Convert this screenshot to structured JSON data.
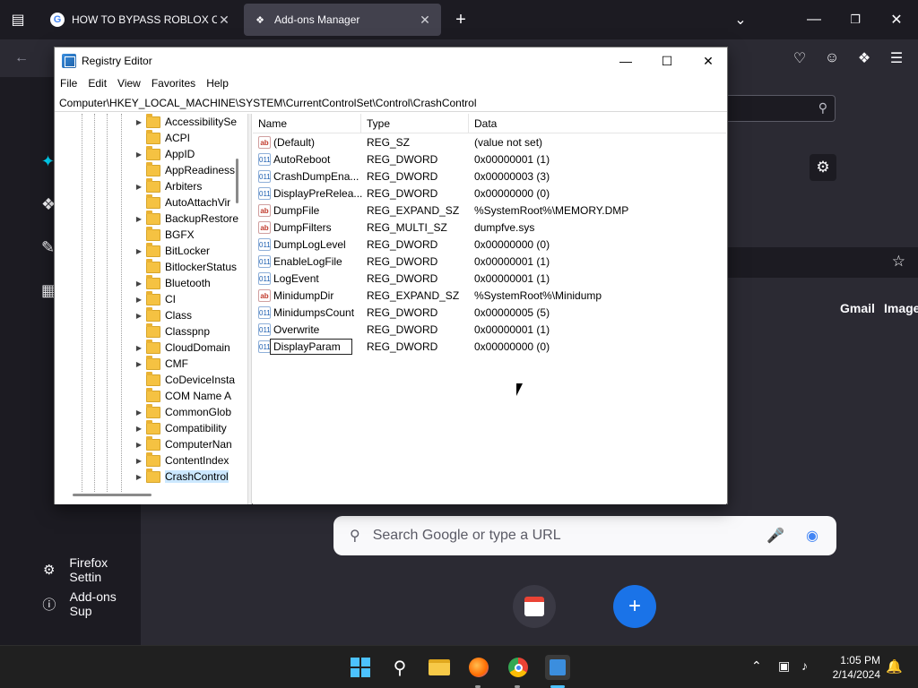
{
  "browser": {
    "tabs": [
      {
        "label": "HOW TO BYPASS ROBLOX CAP",
        "favicon": "google-g-icon"
      },
      {
        "label": "Add-ons Manager",
        "favicon": "puzzle-icon"
      }
    ],
    "sidebar_links": [
      {
        "label": "Firefox Settin",
        "icon": "gear-icon"
      },
      {
        "label": "Add-ons Sup",
        "icon": "help-circle-icon"
      }
    ],
    "google_links": {
      "gmail": "Gmail",
      "images": "Image"
    },
    "search_placeholder": "Search Google or type a URL"
  },
  "regedit": {
    "title": "Registry Editor",
    "menu": [
      "File",
      "Edit",
      "View",
      "Favorites",
      "Help"
    ],
    "address": "Computer\\HKEY_LOCAL_MACHINE\\SYSTEM\\CurrentControlSet\\Control\\CrashControl",
    "tree": [
      {
        "name": "AccessibilitySe",
        "expandable": true
      },
      {
        "name": "ACPI",
        "expandable": false
      },
      {
        "name": "AppID",
        "expandable": true
      },
      {
        "name": "AppReadiness",
        "expandable": false
      },
      {
        "name": "Arbiters",
        "expandable": true
      },
      {
        "name": "AutoAttachVir",
        "expandable": false
      },
      {
        "name": "BackupRestore",
        "expandable": true
      },
      {
        "name": "BGFX",
        "expandable": false
      },
      {
        "name": "BitLocker",
        "expandable": true
      },
      {
        "name": "BitlockerStatus",
        "expandable": false
      },
      {
        "name": "Bluetooth",
        "expandable": true
      },
      {
        "name": "CI",
        "expandable": true
      },
      {
        "name": "Class",
        "expandable": true
      },
      {
        "name": "Classpnp",
        "expandable": false
      },
      {
        "name": "CloudDomain",
        "expandable": true
      },
      {
        "name": "CMF",
        "expandable": true
      },
      {
        "name": "CoDeviceInsta",
        "expandable": false
      },
      {
        "name": "COM Name A",
        "expandable": false
      },
      {
        "name": "CommonGlob",
        "expandable": true
      },
      {
        "name": "Compatibility",
        "expandable": true
      },
      {
        "name": "ComputerNan",
        "expandable": true
      },
      {
        "name": "ContentIndex",
        "expandable": true
      },
      {
        "name": "CrashControl",
        "expandable": true,
        "selected": true
      }
    ],
    "columns": {
      "name": "Name",
      "type": "Type",
      "data": "Data"
    },
    "values": [
      {
        "name": "(Default)",
        "type": "REG_SZ",
        "data": "(value not set)",
        "icon": "string-value-icon"
      },
      {
        "name": "AutoReboot",
        "type": "REG_DWORD",
        "data": "0x00000001 (1)",
        "icon": "binary-value-icon"
      },
      {
        "name": "CrashDumpEna...",
        "type": "REG_DWORD",
        "data": "0x00000003 (3)",
        "icon": "binary-value-icon"
      },
      {
        "name": "DisplayPreRelea...",
        "type": "REG_DWORD",
        "data": "0x00000000 (0)",
        "icon": "binary-value-icon"
      },
      {
        "name": "DumpFile",
        "type": "REG_EXPAND_SZ",
        "data": "%SystemRoot%\\MEMORY.DMP",
        "icon": "string-value-icon"
      },
      {
        "name": "DumpFilters",
        "type": "REG_MULTI_SZ",
        "data": "dumpfve.sys",
        "icon": "string-value-icon"
      },
      {
        "name": "DumpLogLevel",
        "type": "REG_DWORD",
        "data": "0x00000000 (0)",
        "icon": "binary-value-icon"
      },
      {
        "name": "EnableLogFile",
        "type": "REG_DWORD",
        "data": "0x00000001 (1)",
        "icon": "binary-value-icon"
      },
      {
        "name": "LogEvent",
        "type": "REG_DWORD",
        "data": "0x00000001 (1)",
        "icon": "binary-value-icon"
      },
      {
        "name": "MinidumpDir",
        "type": "REG_EXPAND_SZ",
        "data": "%SystemRoot%\\Minidump",
        "icon": "string-value-icon"
      },
      {
        "name": "MinidumpsCount",
        "type": "REG_DWORD",
        "data": "0x00000005 (5)",
        "icon": "binary-value-icon"
      },
      {
        "name": "Overwrite",
        "type": "REG_DWORD",
        "data": "0x00000001 (1)",
        "icon": "binary-value-icon"
      }
    ],
    "rename_row": {
      "value": "DisplayParam",
      "type": "REG_DWORD",
      "data": "0x00000000 (0)"
    }
  },
  "taskbar": {
    "time": "1:05 PM",
    "date": "2/14/2024"
  },
  "colors": {
    "accent": "#0078d4",
    "firefox_dark": "#1c1b22",
    "selection": "#cce8ff"
  }
}
